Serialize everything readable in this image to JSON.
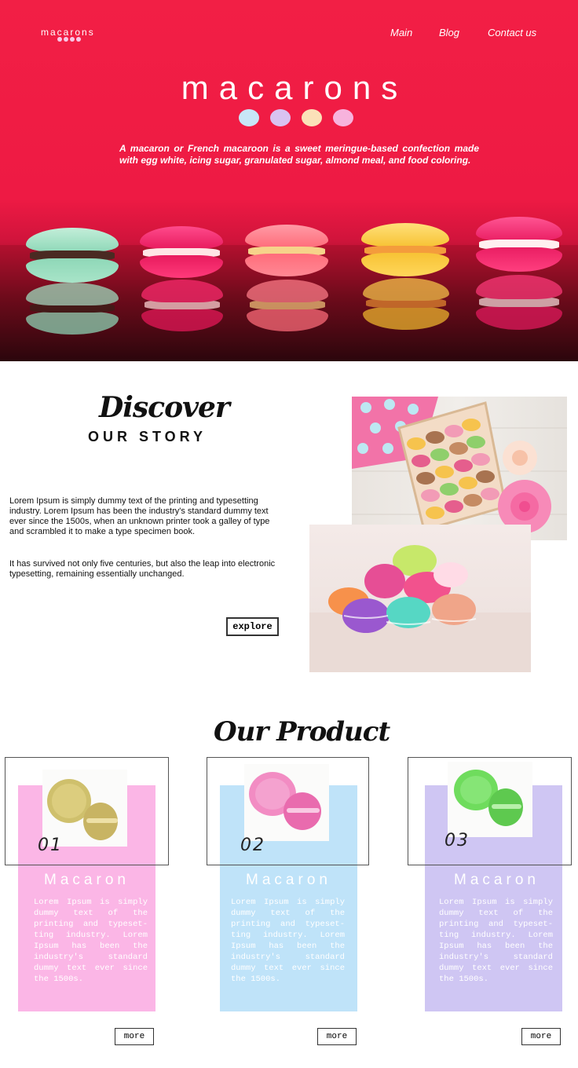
{
  "header": {
    "logo": "macarons",
    "nav": [
      "Main",
      "Blog",
      "Contact us"
    ]
  },
  "hero": {
    "title": "macarons",
    "dot_colors": [
      "#c8e6f7",
      "#d9c2f0",
      "#fbe1b8",
      "#f7b3dd"
    ],
    "description": "A macaron or French macaroon is a sweet meringue-based confection made with egg white, icing sugar, granulated sugar, almond meal, and food coloring."
  },
  "story": {
    "heading_script": "Discover",
    "heading": "OUR STORY",
    "paragraph_1": "Lorem Ipsum is simply dummy text of the printing and typesetting industry. Lorem Ipsum has been the industry's standard dummy text ever since the 1500s, when an unknown printer took a galley of type and scrambled it to make a type specimen book.",
    "paragraph_2": "It has survived not only five centuries, but also the leap into electronic typesetting, remaining essentially unchanged.",
    "button": "explore"
  },
  "products": {
    "heading": "Our Product",
    "items": [
      {
        "number": "01",
        "name": "Macaron",
        "text": "Lorem Ipsum is simply dummy text of the printing and typeset-ting industry. Lorem Ipsum has been the industry's standard dummy text ever since the 1500s.",
        "button": "more",
        "color": "#fbb6e6"
      },
      {
        "number": "02",
        "name": "Macaron",
        "text": "Lorem Ipsum is simply dummy text of the printing and typeset-ting industry. Lorem Ipsum has been the industry's standard dummy text ever since the 1500s.",
        "button": "more",
        "color": "#bfe3f9"
      },
      {
        "number": "03",
        "name": "Macaron",
        "text": "Lorem Ipsum is simply dummy text of the printing and typeset-ting industry. Lorem Ipsum has been the industry's standard dummy text ever since the 1500s.",
        "button": "more",
        "color": "#cfc6f3"
      }
    ]
  }
}
